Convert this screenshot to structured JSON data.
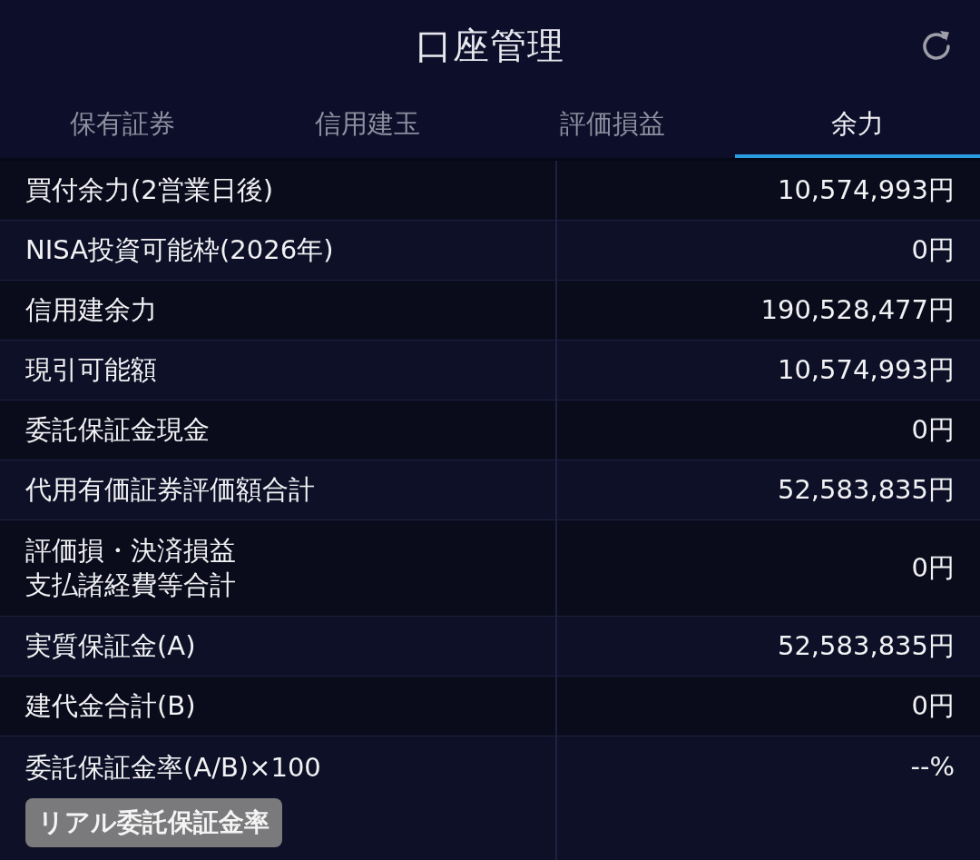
{
  "header": {
    "title": "口座管理"
  },
  "tabs": [
    {
      "label": "保有証券",
      "selected": false
    },
    {
      "label": "信用建玉",
      "selected": false
    },
    {
      "label": "評価損益",
      "selected": false
    },
    {
      "label": "余力",
      "selected": true
    }
  ],
  "rows": [
    {
      "label": "買付余力(2営業日後)",
      "value": "10,574,993円"
    },
    {
      "label": "NISA投資可能枠(2026年)",
      "value": "0円"
    },
    {
      "label": "信用建余力",
      "value": "190,528,477円"
    },
    {
      "label": "現引可能額",
      "value": "10,574,993円"
    },
    {
      "label": "委託保証金現金",
      "value": "0円"
    },
    {
      "label": "代用有価証券評価額合計",
      "value": "52,583,835円"
    },
    {
      "label": [
        "評価損・決済損益",
        "支払諸経費等合計"
      ],
      "value": "0円"
    },
    {
      "label": "実質保証金(A)",
      "value": "52,583,835円"
    },
    {
      "label": "建代金合計(B)",
      "value": "0円"
    },
    {
      "label": "委託保証金率(A/B)×100",
      "value": "--%",
      "button": {
        "label": "リアル委託保証金率"
      }
    }
  ]
}
